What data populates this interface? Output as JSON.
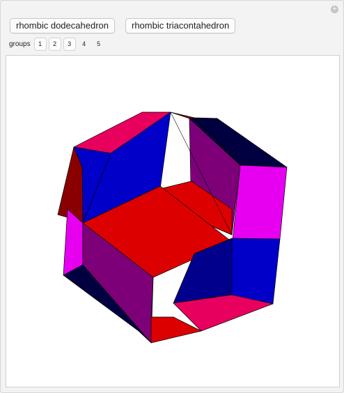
{
  "controls": {
    "close_symbol": "+",
    "buttons": [
      "rhombic dodecahedron",
      "rhombic triacontahedron"
    ],
    "groups_label": "groups",
    "groups": [
      "1",
      "2",
      "3",
      "4",
      "5"
    ]
  },
  "colors": {
    "red": "#dd0000",
    "crimson": "#e8005e",
    "blue": "#0000c8",
    "navy": "#00008c",
    "purple": "#7d0079",
    "magenta": "#e600ef",
    "maroon": "#8a0000",
    "dark_navy": "#000040"
  }
}
